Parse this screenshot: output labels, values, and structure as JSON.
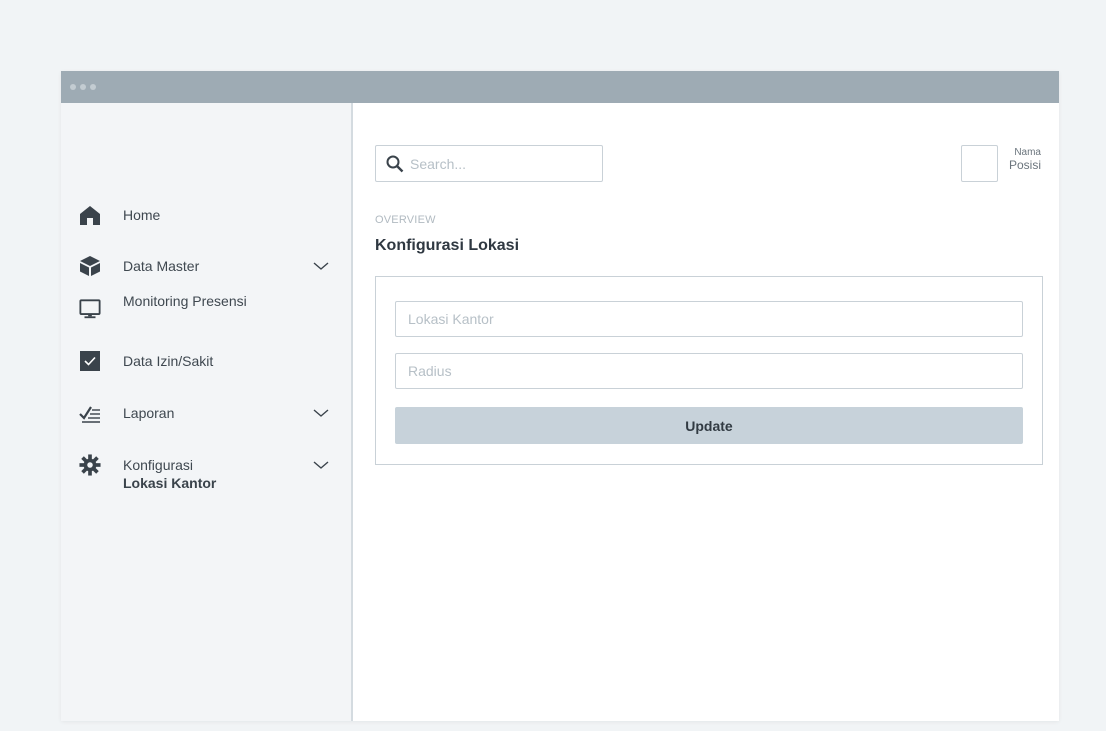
{
  "window": {
    "titlebar_color": "#9eabb4"
  },
  "sidebar": {
    "items": [
      {
        "label": "Home",
        "icon": "home-icon",
        "has_dropdown": false
      },
      {
        "label": "Data Master",
        "icon": "box-icon",
        "has_dropdown": true
      },
      {
        "label": "Monitoring Presensi",
        "icon": "monitor-icon",
        "has_dropdown": false
      },
      {
        "label": "Data Izin/Sakit",
        "icon": "checkbox-icon",
        "has_dropdown": false
      },
      {
        "label": "Laporan",
        "icon": "checklist-icon",
        "has_dropdown": true
      },
      {
        "label": "Konfigurasi",
        "icon": "gear-icon",
        "has_dropdown": true,
        "expanded": true
      }
    ],
    "subitems": {
      "konfigurasi": [
        {
          "label": "Lokasi Kantor",
          "active": true
        }
      ]
    }
  },
  "header": {
    "search": {
      "placeholder": "Search...",
      "value": "",
      "icon": "search-icon"
    },
    "user": {
      "name": "Nama",
      "position": "Posisi"
    }
  },
  "main": {
    "overline": "OVERVIEW",
    "title": "Konfigurasi Lokasi",
    "form": {
      "fields": [
        {
          "placeholder": "Lokasi Kantor",
          "value": ""
        },
        {
          "placeholder": "Radius",
          "value": ""
        }
      ],
      "submit_label": "Update"
    }
  },
  "colors": {
    "sidebar_bg": "#f3f5f7",
    "button_bg": "#c7d2da",
    "border": "#c9d1d7",
    "page_bg": "#f1f4f6"
  }
}
